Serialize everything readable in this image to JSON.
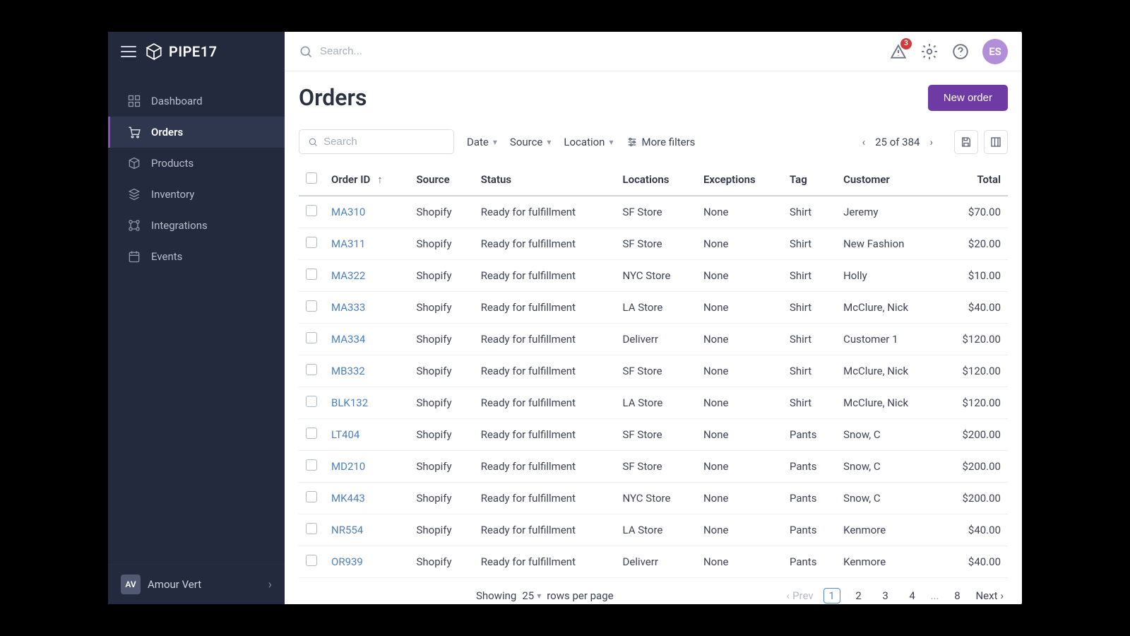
{
  "brand": {
    "name": "PIPE17"
  },
  "topbar": {
    "search_placeholder": "Search...",
    "notification_count": "3",
    "avatar_initials": "ES"
  },
  "sidebar": {
    "items": [
      {
        "label": "Dashboard"
      },
      {
        "label": "Orders"
      },
      {
        "label": "Products"
      },
      {
        "label": "Inventory"
      },
      {
        "label": "Integrations"
      },
      {
        "label": "Events"
      }
    ],
    "footer": {
      "badge": "AV",
      "label": "Amour Vert"
    }
  },
  "page": {
    "title": "Orders",
    "new_order_label": "New order"
  },
  "filters": {
    "search_placeholder": "Search",
    "date_label": "Date",
    "source_label": "Source",
    "location_label": "Location",
    "more_label": "More filters",
    "page_summary": "25 of 384"
  },
  "table": {
    "headers": {
      "order_id": "Order ID",
      "source": "Source",
      "status": "Status",
      "locations": "Locations",
      "exceptions": "Exceptions",
      "tag": "Tag",
      "customer": "Customer",
      "total": "Total"
    },
    "rows": [
      {
        "id": "MA310",
        "source": "Shopify",
        "status": "Ready for fulfillment",
        "location": "SF Store",
        "exceptions": "None",
        "tag": "Shirt",
        "customer": "Jeremy",
        "total": "$70.00"
      },
      {
        "id": "MA311",
        "source": "Shopify",
        "status": "Ready for fulfillment",
        "location": "SF Store",
        "exceptions": "None",
        "tag": "Shirt",
        "customer": "New Fashion",
        "total": "$20.00"
      },
      {
        "id": "MA322",
        "source": "Shopify",
        "status": "Ready for fulfillment",
        "location": "NYC Store",
        "exceptions": "None",
        "tag": "Shirt",
        "customer": "Holly",
        "total": "$10.00"
      },
      {
        "id": "MA333",
        "source": "Shopify",
        "status": "Ready for fulfillment",
        "location": "LA Store",
        "exceptions": "None",
        "tag": "Shirt",
        "customer": "McClure, Nick",
        "total": "$40.00"
      },
      {
        "id": "MA334",
        "source": "Shopify",
        "status": "Ready for fulfillment",
        "location": "Deliverr",
        "exceptions": "None",
        "tag": "Shirt",
        "customer": "Customer 1",
        "total": "$120.00"
      },
      {
        "id": "MB332",
        "source": "Shopify",
        "status": "Ready for fulfillment",
        "location": "SF Store",
        "exceptions": "None",
        "tag": "Shirt",
        "customer": "McClure, Nick",
        "total": "$120.00"
      },
      {
        "id": "BLK132",
        "source": "Shopify",
        "status": "Ready for fulfillment",
        "location": "LA Store",
        "exceptions": "None",
        "tag": "Shirt",
        "customer": "McClure, Nick",
        "total": "$120.00"
      },
      {
        "id": "LT404",
        "source": "Shopify",
        "status": "Ready for fulfillment",
        "location": "SF Store",
        "exceptions": "None",
        "tag": "Pants",
        "customer": "Snow, C",
        "total": "$200.00"
      },
      {
        "id": "MD210",
        "source": "Shopify",
        "status": "Ready for fulfillment",
        "location": "SF Store",
        "exceptions": "None",
        "tag": "Pants",
        "customer": "Snow, C",
        "total": "$200.00"
      },
      {
        "id": "MK443",
        "source": "Shopify",
        "status": "Ready for fulfillment",
        "location": "NYC Store",
        "exceptions": "None",
        "tag": "Pants",
        "customer": "Snow, C",
        "total": "$200.00"
      },
      {
        "id": "NR554",
        "source": "Shopify",
        "status": "Ready for fulfillment",
        "location": "LA Store",
        "exceptions": "None",
        "tag": "Pants",
        "customer": "Kenmore",
        "total": "$40.00"
      },
      {
        "id": "OR939",
        "source": "Shopify",
        "status": "Ready for fulfillment",
        "location": "Deliverr",
        "exceptions": "None",
        "tag": "Pants",
        "customer": "Kenmore",
        "total": "$40.00"
      }
    ]
  },
  "footer": {
    "showing_label": "Showing",
    "rows_per_value": "25",
    "rows_per_label": "rows per page",
    "prev_label": "Prev",
    "next_label": "Next",
    "pages": [
      "1",
      "2",
      "3",
      "4",
      "...",
      "8"
    ]
  }
}
